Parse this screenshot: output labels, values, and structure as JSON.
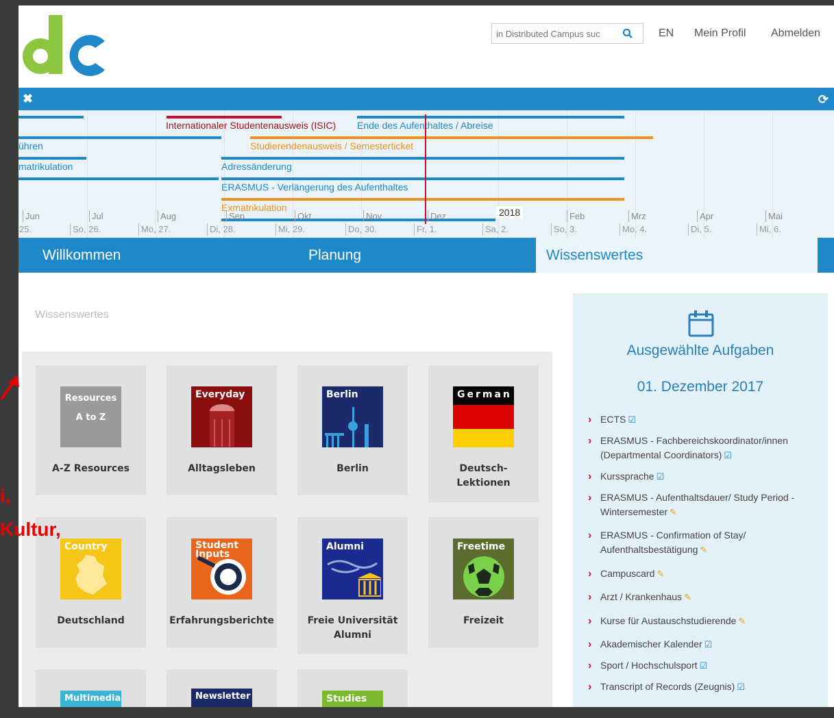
{
  "header": {
    "search_placeholder": "in Distributed Campus suc",
    "lang": "EN",
    "profile": "Mein Profil",
    "logout": "Abmelden"
  },
  "timeline": {
    "items": [
      {
        "label": "Internationaler Studentenausweis (ISIC)",
        "color": "#c8102e"
      },
      {
        "label": "Ende des Aufenthaltes / Abreise",
        "color": "#1e88c9"
      },
      {
        "label": "ühren",
        "color": "#1e88c9"
      },
      {
        "label": "Studierendenausweis / Semesterticket",
        "color": "#f0901e"
      },
      {
        "label": "matrikulation",
        "color": "#1e88c9"
      },
      {
        "label": "Adressänderung",
        "color": "#1e88c9"
      },
      {
        "label": "ERASMUS - Verlängerung des Aufenthaltes",
        "color": "#1e88c9"
      },
      {
        "label": "Exmatrikulation",
        "color": "#f0901e"
      }
    ],
    "months": [
      "Jun",
      "Jul",
      "Aug",
      "Sep",
      "Okt",
      "Nov",
      "Dez",
      "Feb",
      "Mrz",
      "Apr",
      "Mai"
    ],
    "year": "2018",
    "days": [
      "25.",
      "So, 26.",
      "Mo, 27.",
      "Di, 28.",
      "Mi, 29.",
      "Do, 30.",
      "Fr, 1.",
      "Sa, 2.",
      "So, 3.",
      "Mo, 4.",
      "Di, 5.",
      "Mi, 6."
    ]
  },
  "nav": {
    "tabs": [
      "Willkommen",
      "Planung",
      "Wissenswertes"
    ],
    "active": "Wissenswertes"
  },
  "breadcrumb": "Wissenswertes",
  "tiles": [
    {
      "caption": "Resources\nA to Z",
      "label": "A-Z Resources",
      "color": "#9a9a9a"
    },
    {
      "caption": "Everyday",
      "label": "Alltagsleben",
      "color": "#8b0e0e"
    },
    {
      "caption": "Berlin",
      "label": "Berlin",
      "color": "#1b2a6b"
    },
    {
      "caption": "German",
      "label": "Deutsch-\nLektionen",
      "color": "#000000"
    },
    {
      "caption": "Country",
      "label": "Deutschland",
      "color": "#f5c518"
    },
    {
      "caption": "Student Inputs",
      "label": "Erfahrungsberichte",
      "color": "#e8651a"
    },
    {
      "caption": "Alumni",
      "label": "Freie Universität Alumni",
      "color": "#1b2a8f"
    },
    {
      "caption": "Freetime",
      "label": "Freizeit",
      "color": "#5c6b2e"
    },
    {
      "caption": "Multimedia",
      "label": "",
      "color": "#3bb4d4"
    },
    {
      "caption": "Newsletter",
      "label": "",
      "color": "#1b2a6b"
    },
    {
      "caption": "Studies",
      "label": "",
      "color": "#7ab82c"
    }
  ],
  "sidebar": {
    "title": "Ausgewählte Aufgaben",
    "date": "01. Dezember 2017",
    "tasks": [
      {
        "text": "ECTS",
        "icon": "check"
      },
      {
        "text": "ERASMUS - Fachbereichskoordinator/innen (Departmental Coordinators)",
        "icon": "check"
      },
      {
        "text": "Kurssprache",
        "icon": "check"
      },
      {
        "text": "ERASMUS - Aufenthaltsdauer/ Study Period - Wintersemester",
        "icon": "pen"
      },
      {
        "text": "ERASMUS - Confirmation of Stay/ Aufenthaltsbestätigung",
        "icon": "pen"
      },
      {
        "text": "Campuscard",
        "icon": "pen"
      },
      {
        "text": "Arzt / Krankenhaus",
        "icon": "pen"
      },
      {
        "text": "Kurse für Austauschstudierende",
        "icon": "pen"
      },
      {
        "text": "Akademischer Kalender",
        "icon": "check"
      },
      {
        "text": "Sport / Hochschulsport",
        "icon": "check"
      },
      {
        "text": "Transcript of Records (Zeugnis)",
        "icon": "check"
      }
    ]
  },
  "annotation": {
    "line1": "i,",
    "line2": "Kultur,"
  }
}
